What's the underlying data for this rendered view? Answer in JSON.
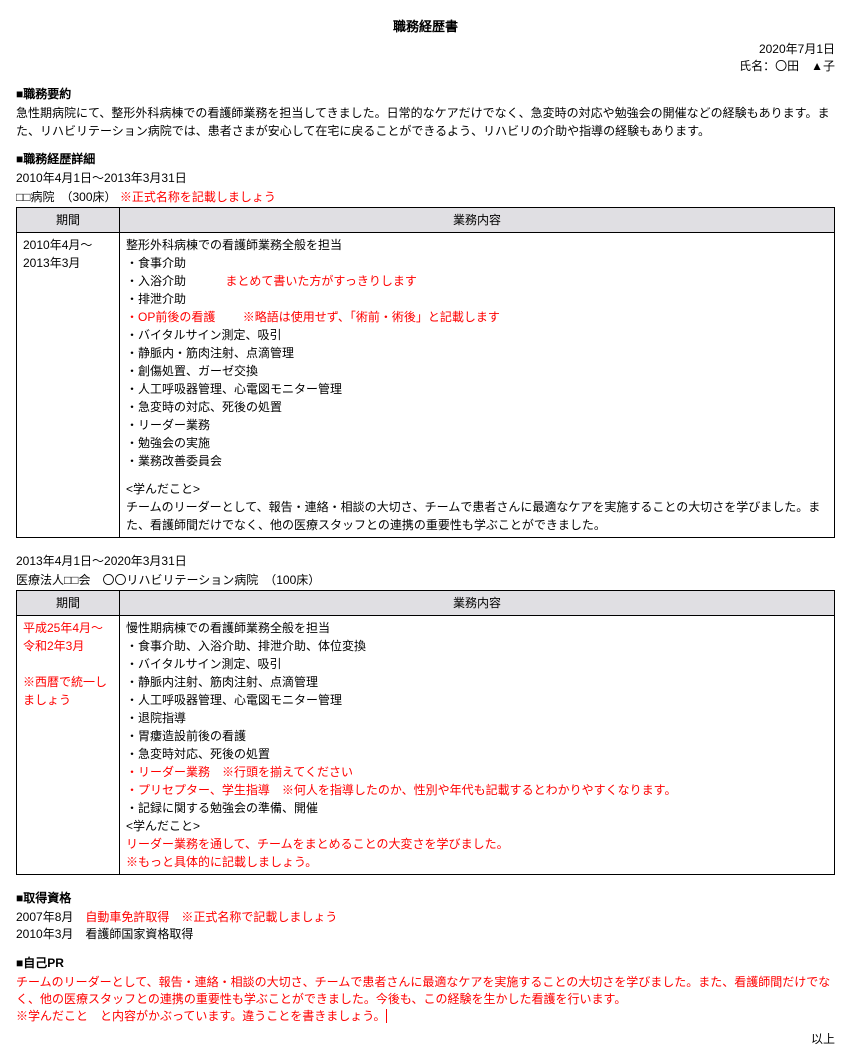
{
  "title": "職務経歴書",
  "date": "2020年7月1日",
  "name_label": "氏名：〇田　▲子",
  "summary": {
    "heading": "■職務要約",
    "text": "急性期病院にて、整形外科病棟での看護師業務を担当してきました。日常的なケアだけでなく、急変時の対応や勉強会の開催などの経験もあります。また、リハビリテーション病院では、患者さまが安心して在宅に戻ることができるよう、リハビリの介助や指導の経験もあります。"
  },
  "history": {
    "heading": "■職務経歴詳細"
  },
  "job1": {
    "period_line": "2010年4月1日～2013年3月31日",
    "hospital": "□□病院　（300床）",
    "hospital_note": "※正式名称を記載しましょう",
    "th_period": "期間",
    "th_content": "業務内容",
    "period": "2010年4月～2013年3月",
    "role": "整形外科病棟での看護師業務全般を担当",
    "b1": "・食事介助",
    "b2": "・入浴介助",
    "b2_note": "まとめて書いた方がすっきりします",
    "b3": "・排泄介助",
    "b4": "・OP前後の看護",
    "b4_note": "※略語は使用せず、「術前・術後」と記載します",
    "b5": "・バイタルサイン測定、吸引",
    "b6": "・静脈内・筋肉注射、点滴管理",
    "b7": "・創傷処置、ガーゼ交換",
    "b8": "・人工呼吸器管理、心電図モニター管理",
    "b9": "・急変時の対応、死後の処置",
    "b10": "・リーダー業務",
    "b11": "・勉強会の実施",
    "b12": "・業務改善委員会",
    "learned_h": "<学んだこと>",
    "learned": "チームのリーダーとして、報告・連絡・相談の大切さ、チームで患者さんに最適なケアを実施することの大切さを学びました。また、看護師間だけでなく、他の医療スタッフとの連携の重要性も学ぶことができました。"
  },
  "job2": {
    "period_line": "2013年4月1日～2020年3月31日",
    "hospital": "医療法人□□会　〇〇リハビリテーション病院　（100床）",
    "th_period": "期間",
    "th_content": "業務内容",
    "period": "平成25年4月～令和2年3月",
    "period_note_blank": "　",
    "period_note": "※西暦で統一しましょう",
    "role": "慢性期病棟での看護師業務全般を担当",
    "b1": "・食事介助、入浴介助、排泄介助、体位変換",
    "b2": "・バイタルサイン測定、吸引",
    "b3": "・静脈内注射、筋肉注射、点滴管理",
    "b4": "・人工呼吸器管理、心電図モニター管理",
    "b5": "・退院指導",
    "b6": "・胃瘻造設前後の看護",
    "b7": "・急変時対応、死後の処置",
    "b8": "・リーダー業務　※行頭を揃えてください",
    "b9": "・プリセプター、学生指導　※何人を指導したのか、性別や年代も記載するとわかりやすくなります。",
    "b10": "・記録に関する勉強会の準備、開催",
    "learned_h": "<学んだこと>",
    "learned": "リーダー業務を通して、チームをまとめることの大変さを学びました。",
    "learned_note": "※もっと具体的に記載しましょう。"
  },
  "qual": {
    "heading": "■取得資格",
    "l1_date": "2007年8月",
    "l1_text": "自動車免許取得　※正式名称で記載しましょう",
    "l2": "2010年3月　看護師国家資格取得"
  },
  "pr": {
    "heading": "■自己PR",
    "text": "チームのリーダーとして、報告・連絡・相談の大切さ、チームで患者さんに最適なケアを実施することの大切さを学びました。また、看護師間だけでなく、他の医療スタッフとの連携の重要性も学ぶことができました。今後も、この経験を生かした看護を行います。",
    "note": "※学んだこと　と内容がかぶっています。違うことを書きましょう。"
  },
  "footer": "以上"
}
